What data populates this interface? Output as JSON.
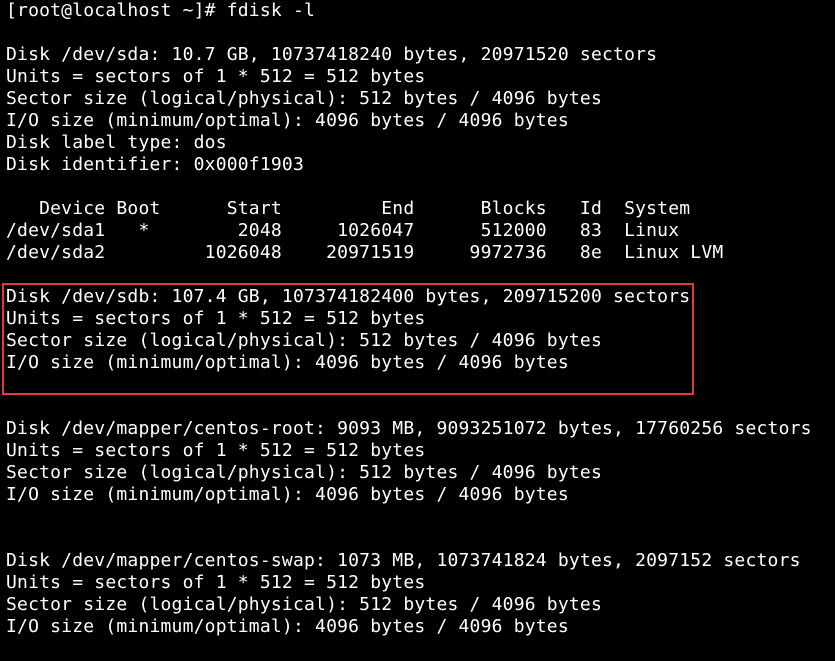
{
  "terminal": {
    "prompt_line": "[root@localhost ~]# fdisk -l",
    "lines": [
      "",
      "Disk /dev/sda: 10.7 GB, 10737418240 bytes, 20971520 sectors",
      "Units = sectors of 1 * 512 = 512 bytes",
      "Sector size (logical/physical): 512 bytes / 4096 bytes",
      "I/O size (minimum/optimal): 4096 bytes / 4096 bytes",
      "Disk label type: dos",
      "Disk identifier: 0x000f1903",
      "",
      "   Device Boot      Start         End      Blocks   Id  System",
      "/dev/sda1   *        2048     1026047      512000   83  Linux",
      "/dev/sda2         1026048    20971519     9972736   8e  Linux LVM",
      "",
      "Disk /dev/sdb: 107.4 GB, 107374182400 bytes, 209715200 sectors",
      "Units = sectors of 1 * 512 = 512 bytes",
      "Sector size (logical/physical): 512 bytes / 4096 bytes",
      "I/O size (minimum/optimal): 4096 bytes / 4096 bytes",
      "",
      "",
      "Disk /dev/mapper/centos-root: 9093 MB, 9093251072 bytes, 17760256 sectors",
      "Units = sectors of 1 * 512 = 512 bytes",
      "Sector size (logical/physical): 512 bytes / 4096 bytes",
      "I/O size (minimum/optimal): 4096 bytes / 4096 bytes",
      "",
      "",
      "Disk /dev/mapper/centos-swap: 1073 MB, 1073741824 bytes, 2097152 sectors",
      "Units = sectors of 1 * 512 = 512 bytes",
      "Sector size (logical/physical): 512 bytes / 4096 bytes",
      "I/O size (minimum/optimal): 4096 bytes / 4096 bytes"
    ]
  },
  "colors": {
    "background": "#000000",
    "text": "#ffffff",
    "highlight": "#e03a3e"
  }
}
